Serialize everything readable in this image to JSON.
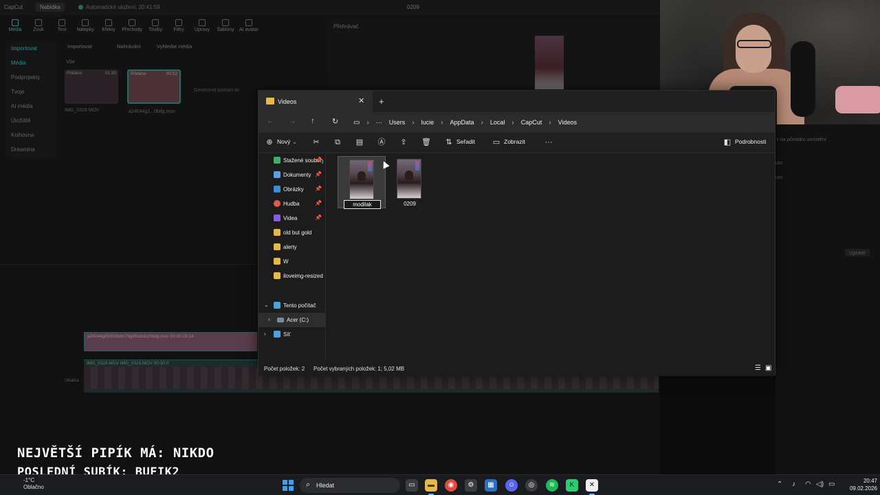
{
  "capcut": {
    "logo": "CapCut",
    "menu": "Nabídka",
    "autosave": "Automatické uložení: 20:41:59",
    "project": "0209",
    "tools": [
      "Média",
      "Zvuk",
      "Text",
      "Nálepky",
      "Efekty",
      "Přechody",
      "Titulky",
      "Filtry",
      "Úpravy",
      "Šablony",
      "AI avatar"
    ],
    "side": [
      "Importovat",
      "Média",
      "Podprojekty",
      "Tvoje",
      "AI média",
      "Úložiště",
      "Knihovna",
      "Dreamina"
    ],
    "media_bar": {
      "import": "Importovat",
      "record": "Nahrávání",
      "search": "Vyhledat média"
    },
    "all": "Vše",
    "clips": [
      {
        "badge": "Přidáno",
        "dur": "01:30",
        "name": "IMG_0316.MOV"
      },
      {
        "badge": "Přidáno",
        "dur": "00:52",
        "name": "a24044g1...0bdg.mov"
      }
    ],
    "generate": "Generovat pomocí AI",
    "player_title": "Přehrávač",
    "track1_label": "a24044g0000cbdrr76g65sdsb20bdg.mov  00:00:29:14",
    "track2_label": "IMG_0316.MOV  IMG_0316.MOV  00:00:0",
    "cover": "Obálka",
    "right_texts": [
      "t na původní umístění",
      "uto",
      "uto",
      "Upravit"
    ]
  },
  "overlay": {
    "line1": "NEJVĚTŠÍ PIPÍK MÁ: NIKDO",
    "line2": "POSLEDNÍ SUBÍK: BUFIK2"
  },
  "explorer": {
    "tab_title": "Videos",
    "breadcrumb": [
      "Users",
      "lucie",
      "AppData",
      "Local",
      "CapCut",
      "Videos"
    ],
    "commands": {
      "new": "Nový",
      "sort": "Seřadit",
      "view": "Zobrazit",
      "details": "Podrobnosti"
    },
    "nav_items": [
      {
        "label": "Stažené soubory",
        "color": "#3fb06a",
        "pinned": true
      },
      {
        "label": "Dokumenty",
        "color": "#5aa0e6",
        "pinned": true
      },
      {
        "label": "Obrázky",
        "color": "#3a8fd8",
        "pinned": true
      },
      {
        "label": "Hudba",
        "color": "#e0594a",
        "pinned": true
      },
      {
        "label": "Videa",
        "color": "#8a5ae0",
        "pinned": true
      },
      {
        "label": "old but gold",
        "color": "#e6b84a",
        "pinned": false
      },
      {
        "label": "alerty",
        "color": "#e6b84a",
        "pinned": false
      },
      {
        "label": "W",
        "color": "#e6b84a",
        "pinned": false
      },
      {
        "label": "iloveimg-resized",
        "color": "#e6b84a",
        "pinned": false
      }
    ],
    "tree": {
      "this_pc": "Tento počítač",
      "drive": "Acer (C:)",
      "network": "Síť"
    },
    "files": [
      {
        "name": "modilak",
        "renaming": true
      },
      {
        "name": "0209",
        "renaming": false
      }
    ],
    "status": {
      "count": "Počet položek: 2",
      "selected": "Počet vybraných položek: 1; 5,02 MB"
    }
  },
  "taskbar": {
    "weather_temp": "-1°C",
    "weather_text": "Oblačno",
    "search": "Hledat",
    "time": "20:47",
    "date": "09.02.2026"
  }
}
